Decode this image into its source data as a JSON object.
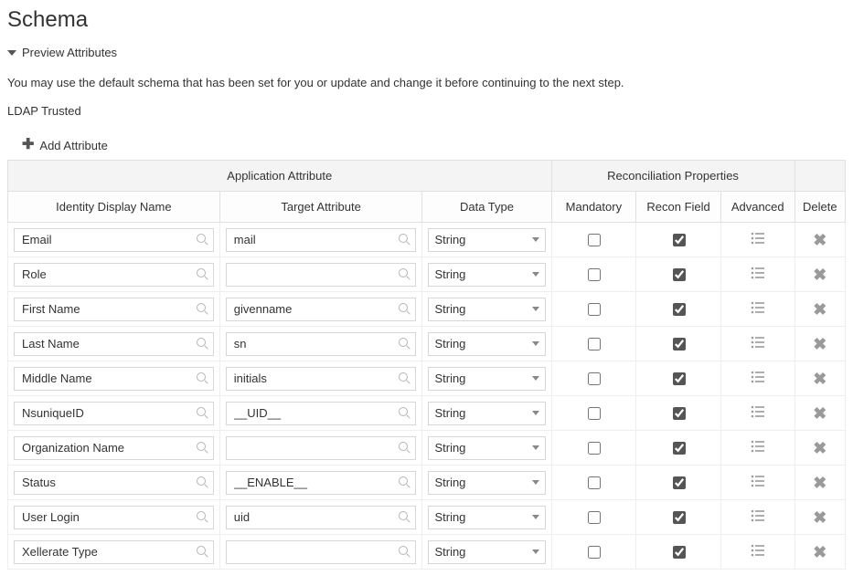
{
  "page": {
    "title": "Schema",
    "section_toggle": "Preview Attributes",
    "help_text": "You may use the default schema that has been set for you or update and change it before continuing to the next step.",
    "subtitle": "LDAP Trusted",
    "add_attribute_label": "Add Attribute"
  },
  "headers": {
    "group_app_attr": "Application Attribute",
    "group_recon": "Reconciliation Properties",
    "identity_display_name": "Identity Display Name",
    "target_attribute": "Target Attribute",
    "data_type": "Data Type",
    "mandatory": "Mandatory",
    "recon_field": "Recon Field",
    "advanced": "Advanced",
    "delete": "Delete"
  },
  "rows": [
    {
      "idn": "Email",
      "tgt": "mail",
      "dt": "String",
      "mandatory": false,
      "recon": true
    },
    {
      "idn": "Role",
      "tgt": "",
      "dt": "String",
      "mandatory": false,
      "recon": true
    },
    {
      "idn": "First Name",
      "tgt": "givenname",
      "dt": "String",
      "mandatory": false,
      "recon": true
    },
    {
      "idn": "Last Name",
      "tgt": "sn",
      "dt": "String",
      "mandatory": false,
      "recon": true
    },
    {
      "idn": "Middle Name",
      "tgt": "initials",
      "dt": "String",
      "mandatory": false,
      "recon": true
    },
    {
      "idn": "NsuniqueID",
      "tgt": "__UID__",
      "dt": "String",
      "mandatory": false,
      "recon": true
    },
    {
      "idn": "Organization Name",
      "tgt": "",
      "dt": "String",
      "mandatory": false,
      "recon": true
    },
    {
      "idn": "Status",
      "tgt": "__ENABLE__",
      "dt": "String",
      "mandatory": false,
      "recon": true
    },
    {
      "idn": "User Login",
      "tgt": "uid",
      "dt": "String",
      "mandatory": false,
      "recon": true
    },
    {
      "idn": "Xellerate Type",
      "tgt": "",
      "dt": "String",
      "mandatory": false,
      "recon": true
    }
  ]
}
